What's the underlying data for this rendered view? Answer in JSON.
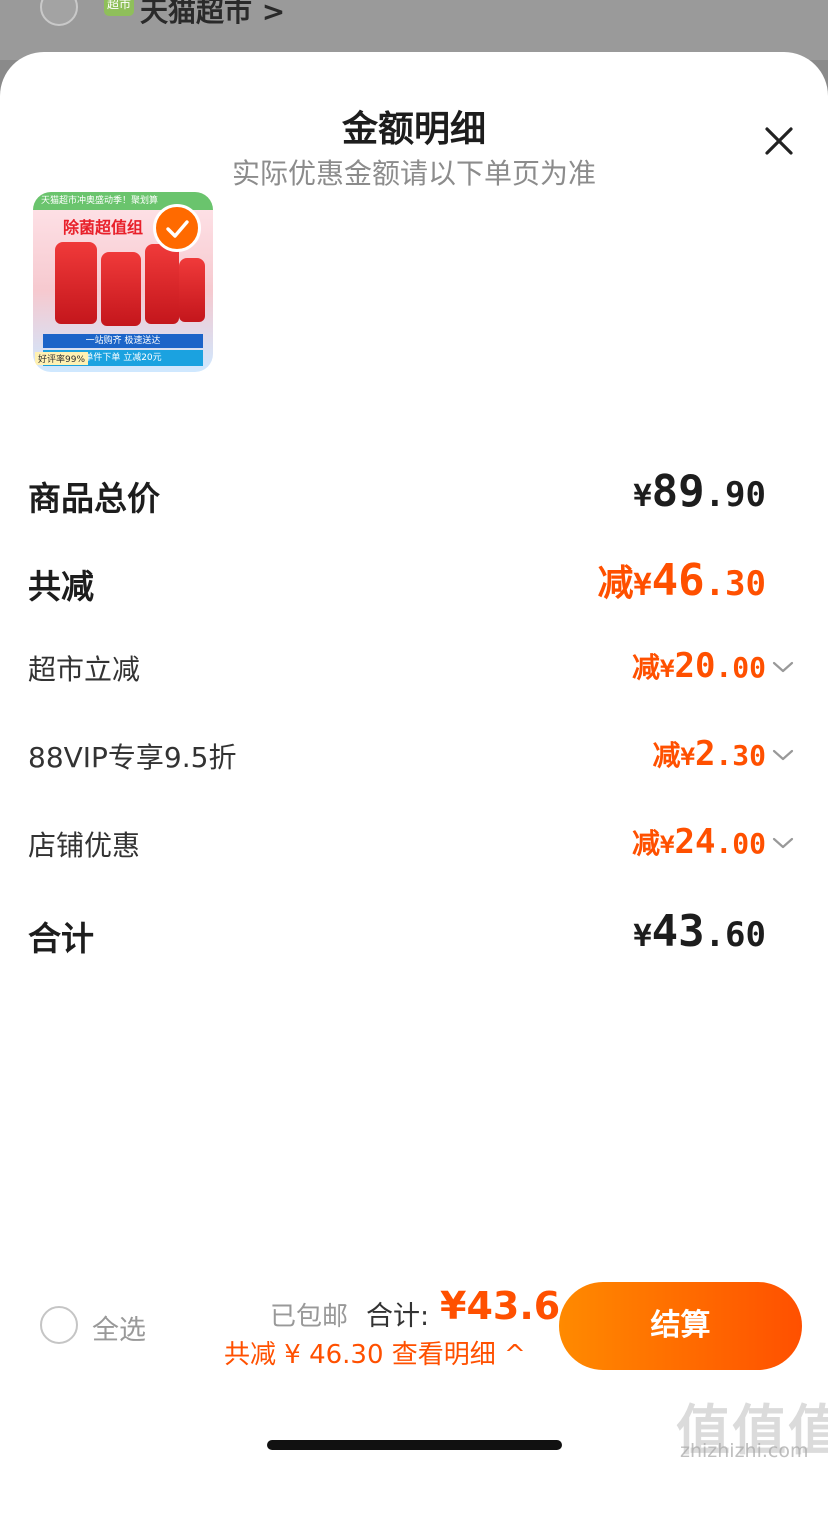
{
  "background": {
    "store_badge": "超市",
    "store_name": "天猫超市 >"
  },
  "header": {
    "title": "金额明细",
    "subtitle": "实际优惠金额请以下单页为准"
  },
  "product": {
    "image_alt": "OMO除菌洗衣液超值组",
    "banner_top": "天猫超市冲奥盛动季！聚划算",
    "banner_main": "除菌超值组",
    "caption": "一站购齐 极速送达",
    "promo": "单件下单 立减20元",
    "rate": "好评率99%",
    "selected": true
  },
  "breakdown": {
    "goods_total": {
      "label": "商品总价",
      "currency": "¥",
      "int": "89",
      "dec": ".90"
    },
    "total_discount": {
      "label": "共减",
      "prefix": "减",
      "currency": "¥",
      "int": "46",
      "dec": ".30"
    },
    "items": [
      {
        "label": "超市立减",
        "prefix": "减",
        "currency": "¥",
        "int": "20",
        "dec": ".00"
      },
      {
        "label": "88VIP专享9.5折",
        "prefix": "减",
        "currency": "¥",
        "int": "2",
        "dec": ".30"
      },
      {
        "label": "店铺优惠",
        "prefix": "减",
        "currency": "¥",
        "int": "24",
        "dec": ".00"
      }
    ],
    "sum": {
      "label": "合计",
      "currency": "¥",
      "int": "43",
      "dec": ".60"
    }
  },
  "footer": {
    "select_all": "全选",
    "shipping": "已包邮",
    "total_label": "合计:",
    "total_value": "¥43.6",
    "saved_text": "共减 ¥ 46.30  查看明细 ^",
    "checkout": "结算"
  },
  "watermark": {
    "text": "值值值",
    "url": "zhizhizhi.com"
  },
  "colors": {
    "accent": "#ff5000",
    "checkout_gradient_start": "#ff8a00"
  }
}
